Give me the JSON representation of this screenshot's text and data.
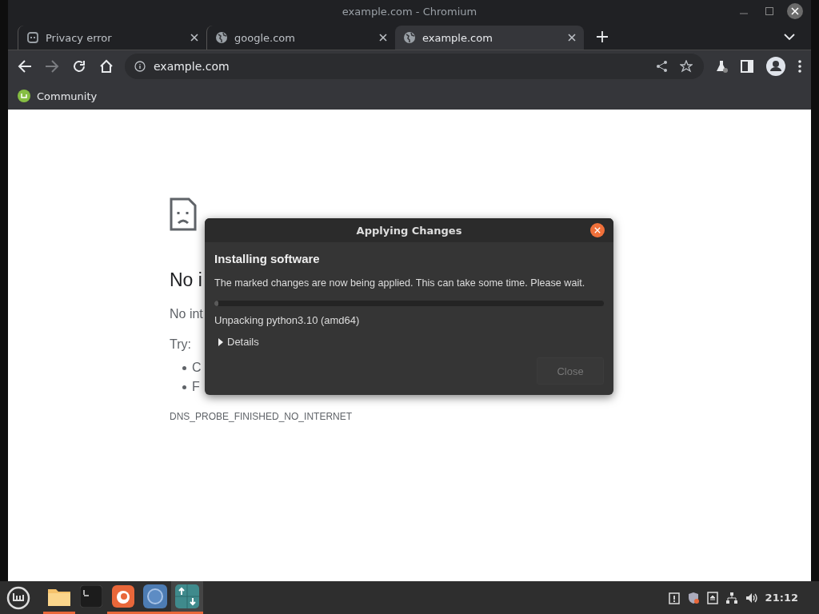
{
  "window": {
    "title": "example.com - Chromium"
  },
  "tabs": [
    {
      "label": "Privacy error",
      "kind": "page",
      "selected": false
    },
    {
      "label": "google.com",
      "kind": "site",
      "selected": false
    },
    {
      "label": "example.com",
      "kind": "site",
      "selected": true
    }
  ],
  "toolbar": {
    "address": "example.com",
    "forward_disabled": true
  },
  "bookmarks": [
    {
      "label": "Community"
    }
  ],
  "error_page": {
    "heading": "No i",
    "message": "No int",
    "try_label": "Try:",
    "suggestions": [
      "C",
      "F"
    ],
    "code": "DNS_PROBE_FINISHED_NO_INTERNET"
  },
  "dialog": {
    "title": "Applying Changes",
    "heading": "Installing software",
    "message": "The marked changes are now being applied. This can take some time. Please wait.",
    "progress": {
      "level": 0.01
    },
    "status": "Unpacking python3.10 (amd64)",
    "details": {
      "label": "Details",
      "expanded": false
    },
    "close_button": {
      "label": "Close",
      "disabled": true
    }
  },
  "taskbar": {
    "apps": [
      {
        "kind": "folder",
        "running": true,
        "selected": false
      },
      {
        "kind": "terminal",
        "running": false,
        "selected": false
      },
      {
        "kind": "firefox",
        "running": true,
        "selected": false
      },
      {
        "kind": "chromium",
        "running": true,
        "selected": false
      },
      {
        "kind": "updater",
        "running": true,
        "selected": true
      }
    ],
    "clock": "21:12"
  }
}
